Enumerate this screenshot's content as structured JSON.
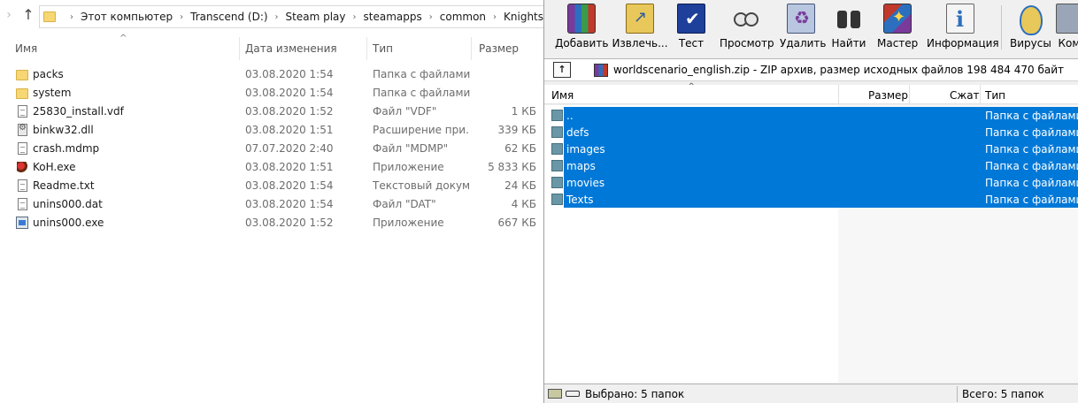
{
  "explorer": {
    "breadcrumb": [
      "Этот компьютер",
      "Transcend (D:)",
      "Steam play",
      "steamapps",
      "common",
      "Knights of Honor"
    ],
    "columns": {
      "name": "Имя",
      "date": "Дата изменения",
      "type": "Тип",
      "size": "Размер"
    },
    "files": [
      {
        "name": "packs",
        "date": "03.08.2020 1:54",
        "type": "Папка с файлами",
        "size": "",
        "icon": "folder-icon"
      },
      {
        "name": "system",
        "date": "03.08.2020 1:54",
        "type": "Папка с файлами",
        "size": "",
        "icon": "folder-icon"
      },
      {
        "name": "25830_install.vdf",
        "date": "03.08.2020 1:52",
        "type": "Файл \"VDF\"",
        "size": "1 КБ",
        "icon": "document-icon"
      },
      {
        "name": "binkw32.dll",
        "date": "03.08.2020 1:51",
        "type": "Расширение при...",
        "size": "339 КБ",
        "icon": "dll-gear-icon"
      },
      {
        "name": "crash.mdmp",
        "date": "07.07.2020 2:40",
        "type": "Файл \"MDMP\"",
        "size": "62 КБ",
        "icon": "document-icon"
      },
      {
        "name": "KoH.exe",
        "date": "03.08.2020 1:51",
        "type": "Приложение",
        "size": "5 833 КБ",
        "icon": "game-exe-icon"
      },
      {
        "name": "Readme.txt",
        "date": "03.08.2020 1:54",
        "type": "Текстовый докум...",
        "size": "24 КБ",
        "icon": "text-file-icon"
      },
      {
        "name": "unins000.dat",
        "date": "03.08.2020 1:54",
        "type": "Файл \"DAT\"",
        "size": "4 КБ",
        "icon": "document-icon"
      },
      {
        "name": "unins000.exe",
        "date": "03.08.2020 1:52",
        "type": "Приложение",
        "size": "667 КБ",
        "icon": "setup-exe-icon"
      }
    ]
  },
  "winrar": {
    "toolbar": [
      {
        "label": "Добавить",
        "icon": "add-archive-icon"
      },
      {
        "label": "Извлечь...",
        "icon": "extract-icon"
      },
      {
        "label": "Тест",
        "icon": "test-icon"
      },
      {
        "label": "Просмотр",
        "icon": "view-icon"
      },
      {
        "label": "Удалить",
        "icon": "delete-icon"
      },
      {
        "label": "Найти",
        "icon": "find-icon"
      },
      {
        "label": "Мастер",
        "icon": "wizard-icon"
      },
      {
        "label": "Информация",
        "icon": "info-icon"
      },
      {
        "label": "Вирусы",
        "icon": "virus-scan-icon"
      },
      {
        "label": "Ком",
        "icon": "comment-icon"
      }
    ],
    "path": "worldscenario_english.zip - ZIP архив, размер исходных файлов 198 484 470 байт",
    "columns": {
      "name": "Имя",
      "size": "Размер",
      "packed": "Сжат",
      "type": "Тип"
    },
    "items": [
      {
        "name": "..",
        "type": "Папка с файлами"
      },
      {
        "name": "defs",
        "type": "Папка с файлами"
      },
      {
        "name": "images",
        "type": "Папка с файлами"
      },
      {
        "name": "maps",
        "type": "Папка с файлами"
      },
      {
        "name": "movies",
        "type": "Папка с файлами"
      },
      {
        "name": "Texts",
        "type": "Папка с файлами"
      }
    ],
    "status": {
      "selected": "Выбрано: 5 папок",
      "total": "Всего: 5 папок"
    },
    "colors": {
      "selection": "#0078d7",
      "folder": "#f7d774"
    }
  }
}
